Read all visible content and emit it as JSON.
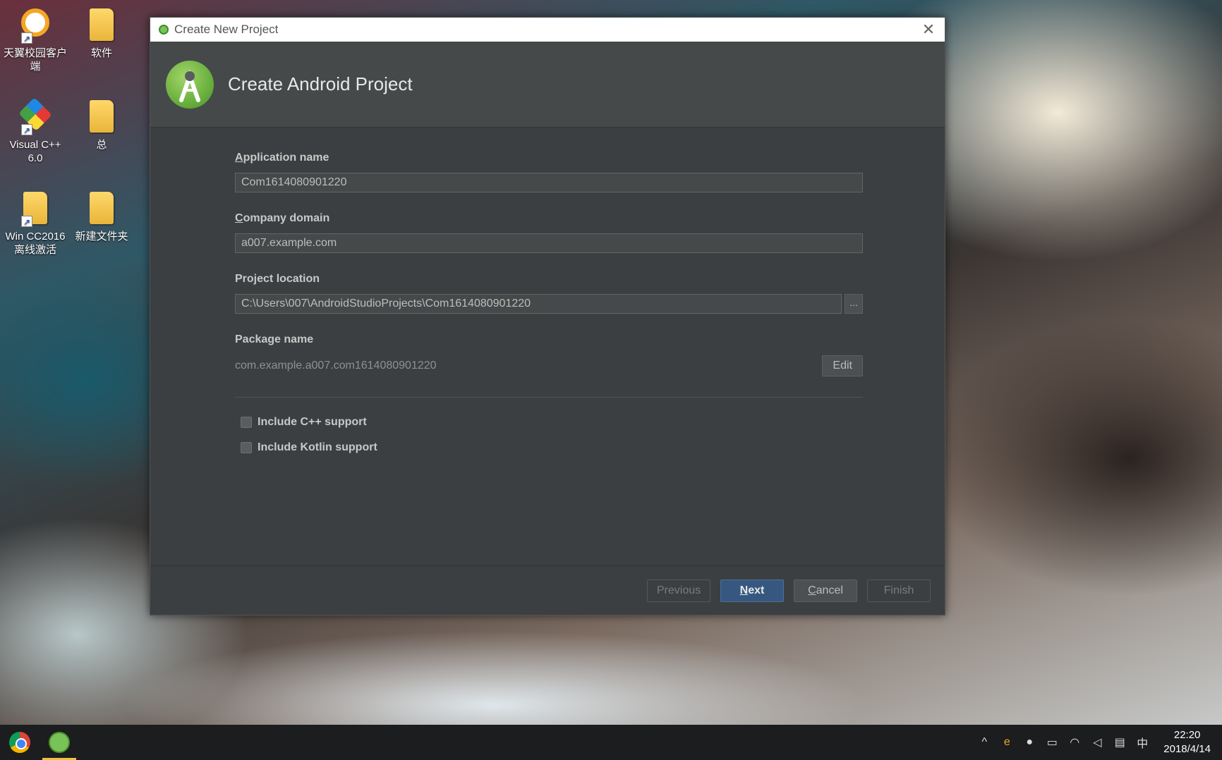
{
  "desktop": {
    "icons": [
      {
        "label": "天翼校园客户端"
      },
      {
        "label": "软件"
      },
      {
        "label": "Visual C++ 6.0"
      },
      {
        "label": "总"
      },
      {
        "label": "Win CC2016 离线激活"
      },
      {
        "label": "新建文件夹"
      }
    ]
  },
  "dialog": {
    "window_title": "Create New Project",
    "header_title": "Create Android Project",
    "app_name": {
      "label_mnemonic": "A",
      "label_rest": "pplication name",
      "value": "Com1614080901220"
    },
    "company_domain": {
      "label_mnemonic": "C",
      "label_rest": "ompany domain",
      "value": "a007.example.com"
    },
    "project_location": {
      "label": "Project location",
      "value": "C:\\Users\\007\\AndroidStudioProjects\\Com1614080901220",
      "browse_label": "..."
    },
    "package_name": {
      "label": "Package name",
      "value": "com.example.a007.com1614080901220",
      "edit_label": "Edit"
    },
    "options": [
      {
        "label": "Include C++ support",
        "checked": false
      },
      {
        "label": "Include Kotlin support",
        "checked": false
      }
    ],
    "footer": {
      "previous": "Previous",
      "next_mnemonic": "N",
      "next_rest": "ext",
      "cancel_mnemonic": "C",
      "cancel_rest": "ancel",
      "finish": "Finish"
    }
  },
  "taskbar": {
    "apps": [
      {
        "icon": "chrome-icon"
      },
      {
        "icon": "android-studio-icon",
        "active": true
      }
    ],
    "tray": {
      "ime": "中",
      "time": "22:20",
      "date": "2018/4/14"
    }
  },
  "colors": {
    "dialog_bg": "#3c3f41",
    "header_bg": "#45494a",
    "primary_button": "#365880",
    "android_green": "#78c257"
  }
}
